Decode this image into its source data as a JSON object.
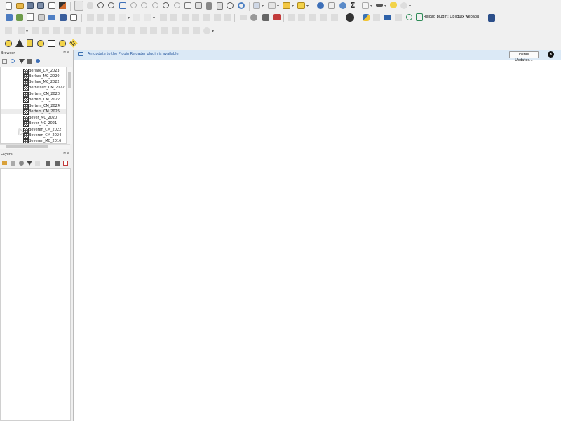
{
  "toolbar": {
    "reload_plugin_label": "Reload plugin: Obliquix webapp",
    "sigma_glyph": "Σ"
  },
  "browser": {
    "title": "Browser",
    "items": [
      {
        "label": "Berlare_CM_2023"
      },
      {
        "label": "Berlare_MC_2020"
      },
      {
        "label": "Berlare_MC_2022"
      },
      {
        "label": "Bernissart_CM_2022"
      },
      {
        "label": "Bertem_CM_2020"
      },
      {
        "label": "Bertem_CM_2022"
      },
      {
        "label": "Bertem_CM_2024"
      },
      {
        "label": "Bertem_CM_2025"
      },
      {
        "label": "Bever_MC_2020"
      },
      {
        "label": "Bever_MC_2021"
      },
      {
        "label": "Beveren_CM_2022"
      },
      {
        "label": "Beveren_CM_2024"
      },
      {
        "label": "Beveren_MC_2016"
      }
    ],
    "selected_index": 7
  },
  "layers": {
    "title": "Layers"
  },
  "message_bar": {
    "text": "An update to the Plugin Reloader plugin is available",
    "button_label": "Install Updates...",
    "close_glyph": "✕"
  },
  "colors": {
    "message_bg": "#dbe9f6",
    "message_text": "#2a5aa0"
  }
}
